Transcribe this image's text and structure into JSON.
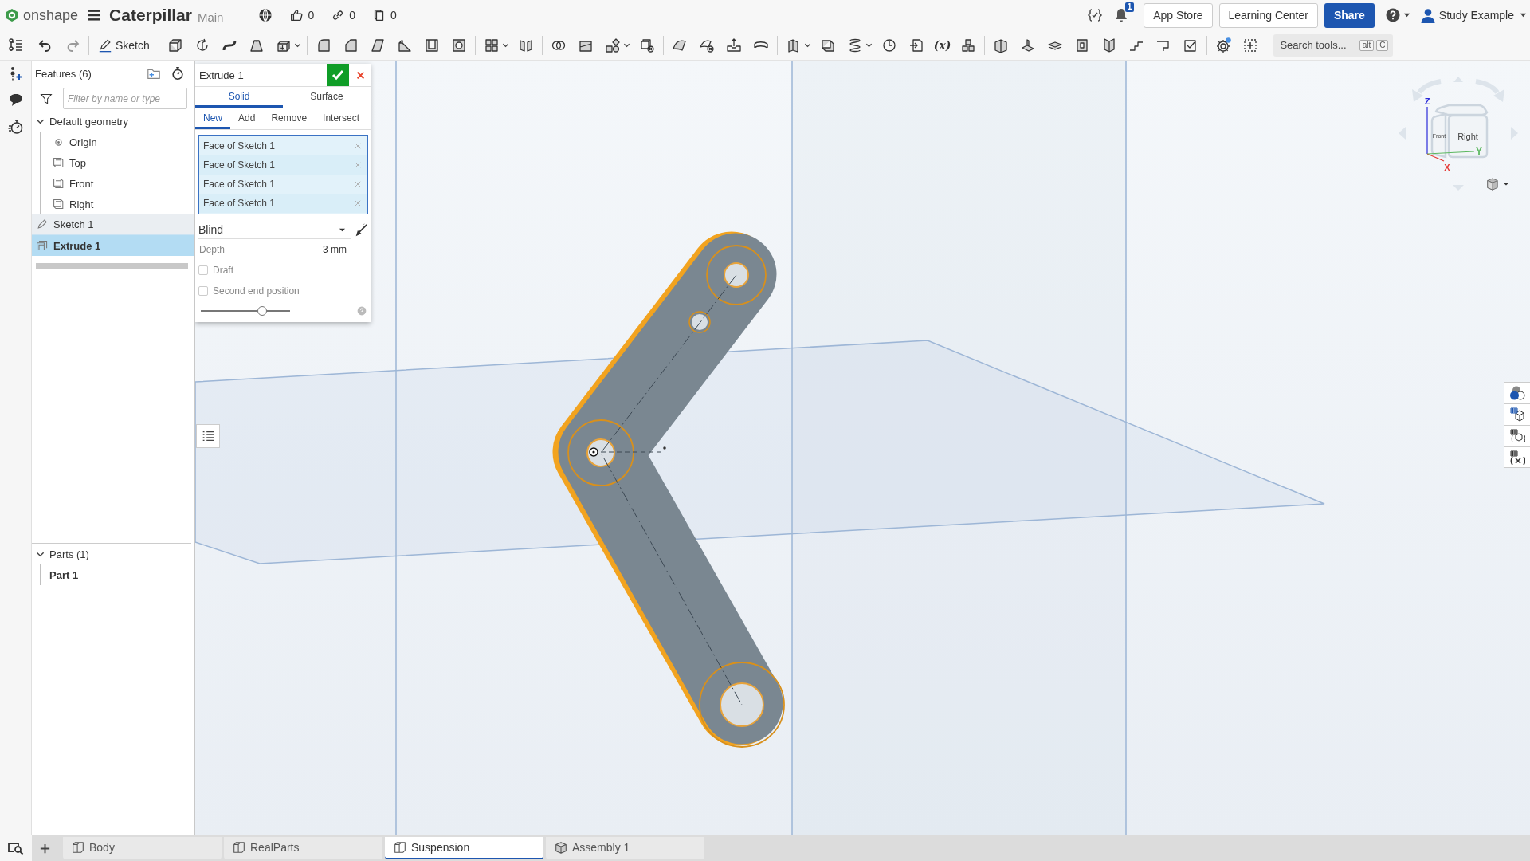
{
  "header": {
    "logo_text": "onshape",
    "document_title": "Caterpillar",
    "branch": "Main",
    "counters": [
      {
        "kind": "likes",
        "value": "0"
      },
      {
        "kind": "links",
        "value": "0"
      },
      {
        "kind": "copies",
        "value": "0"
      }
    ],
    "notification_count": "1",
    "buttons": [
      "App Store",
      "Learning Center"
    ],
    "share_button": "Share",
    "user_name": "Study Example"
  },
  "toolbar": {
    "sketch_button": "Sketch",
    "variable_button": "(x)",
    "search": {
      "placeholder": "Search tools...",
      "shortcut_keys": [
        "alt",
        "C"
      ]
    }
  },
  "feature_panel": {
    "title": "Features (6)",
    "filter": {
      "placeholder": "Filter by name or type"
    },
    "tree": [
      {
        "label": "Default geometry",
        "kind": "group",
        "expanded": true,
        "selected": false,
        "highlighted": false,
        "children": [
          {
            "label": "Origin",
            "kind": "origin",
            "selected": false,
            "highlighted": false
          },
          {
            "label": "Top",
            "kind": "plane",
            "selected": false,
            "highlighted": false
          },
          {
            "label": "Front",
            "kind": "plane",
            "selected": false,
            "highlighted": false
          },
          {
            "label": "Right",
            "kind": "plane",
            "selected": false,
            "highlighted": false
          }
        ]
      },
      {
        "label": "Sketch 1",
        "kind": "sketch",
        "selected": false,
        "highlighted": true
      },
      {
        "label": "Extrude 1",
        "kind": "extrude",
        "selected": true,
        "highlighted": false
      }
    ],
    "parts": {
      "title": "Parts (1)",
      "expanded": true,
      "items": [
        "Part 1"
      ]
    }
  },
  "extrude_dialog": {
    "title": "Extrude 1",
    "type_tabs": [
      {
        "label": "Solid",
        "selected": true
      },
      {
        "label": "Surface",
        "selected": false
      }
    ],
    "operation_tabs": [
      {
        "label": "New",
        "selected": true
      },
      {
        "label": "Add",
        "selected": false
      },
      {
        "label": "Remove",
        "selected": false
      },
      {
        "label": "Intersect",
        "selected": false
      }
    ],
    "selections": [
      "Face of Sketch 1",
      "Face of Sketch 1",
      "Face of Sketch 1",
      "Face of Sketch 1"
    ],
    "end_type": "Blind",
    "depth": {
      "label": "Depth",
      "value": "3 mm"
    },
    "options": [
      {
        "label": "Draft",
        "checked": false
      },
      {
        "label": "Second end position",
        "checked": false
      }
    ],
    "slider": {
      "level": 0.69
    }
  },
  "view_cube": {
    "faces": [
      "Front",
      "Right"
    ],
    "axes": [
      {
        "label": "Z",
        "color": "#2b2bd9"
      },
      {
        "label": "X",
        "color": "#e53935"
      },
      {
        "label": "Y",
        "color": "#5cb860"
      }
    ]
  },
  "tabs": [
    {
      "label": "Body",
      "kind": "part_studio",
      "selected": false
    },
    {
      "label": "RealParts",
      "kind": "part_studio",
      "selected": false
    },
    {
      "label": "Suspension",
      "kind": "part_studio",
      "selected": true
    },
    {
      "label": "Assembly 1",
      "kind": "assembly",
      "selected": false
    }
  ]
}
